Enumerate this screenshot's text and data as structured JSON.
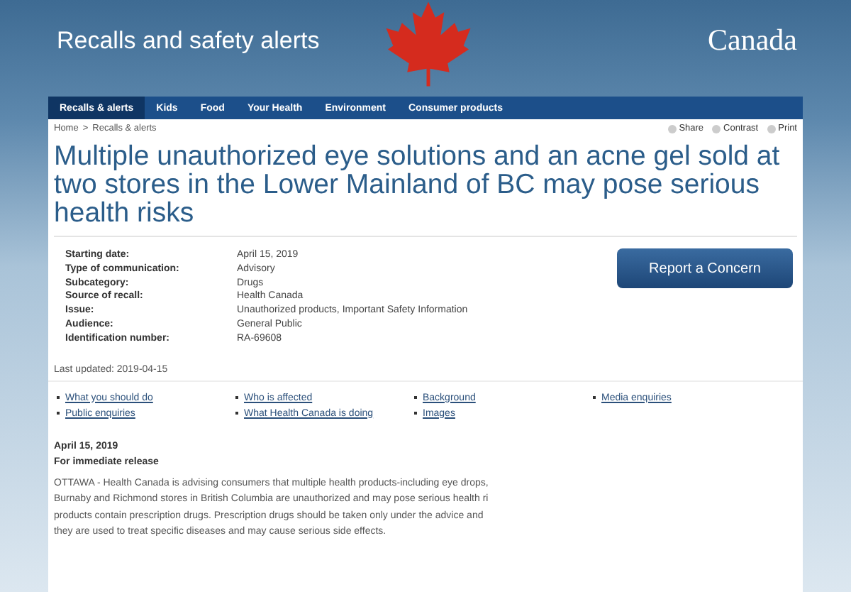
{
  "header": {
    "title": "Recalls and safety alerts",
    "wordmark": "Canada"
  },
  "nav": [
    {
      "label": "Recalls & alerts",
      "selected": true
    },
    {
      "label": "Kids",
      "selected": false
    },
    {
      "label": "Food",
      "selected": false
    },
    {
      "label": "Your Health",
      "selected": false
    },
    {
      "label": "Environment",
      "selected": false
    },
    {
      "label": "Consumer products",
      "selected": false
    }
  ],
  "breadcrumb": {
    "items": [
      "Home",
      "Recalls & alerts"
    ],
    "separator": ">"
  },
  "tools": [
    "Share",
    "Contrast",
    "Print"
  ],
  "heading": "Multiple unauthorized eye solutions and an acne gel sold at two stores in the Lower Mainland of BC may pose serious health risks",
  "details": [
    {
      "label": "Starting date:",
      "value": "April 15, 2019"
    },
    {
      "label": "Type of communication:",
      "value": "Advisory"
    },
    {
      "label": "Subcategory:",
      "value": "Drugs"
    },
    {
      "label": "Source of recall:",
      "value": "Health Canada"
    },
    {
      "label": "Issue:",
      "value": "Unauthorized products, Important Safety Information"
    },
    {
      "label": "Audience:",
      "value": "General Public"
    },
    {
      "label": "Identification number:",
      "value": "RA-69608"
    }
  ],
  "report_button": "Report a Concern",
  "last_updated": "Last updated: 2019-04-15",
  "links": [
    [
      "What you should do",
      "Public enquiries"
    ],
    [
      "Who is affected",
      "What Health Canada is doing"
    ],
    [
      "Background",
      "Images"
    ],
    [
      "Media enquiries"
    ]
  ],
  "release": {
    "date": "April 15, 2019",
    "label": "For immediate release",
    "lines": [
      "OTTAWA - Health Canada is advising consumers that multiple health products-including eye drops,",
      "Burnaby and Richmond stores in British Columbia are unauthorized and may pose serious health ri",
      "products contain prescription drugs. Prescription drugs should be taken only under the advice and",
      "they are used to treat specific diseases and may cause serious side effects."
    ]
  }
}
